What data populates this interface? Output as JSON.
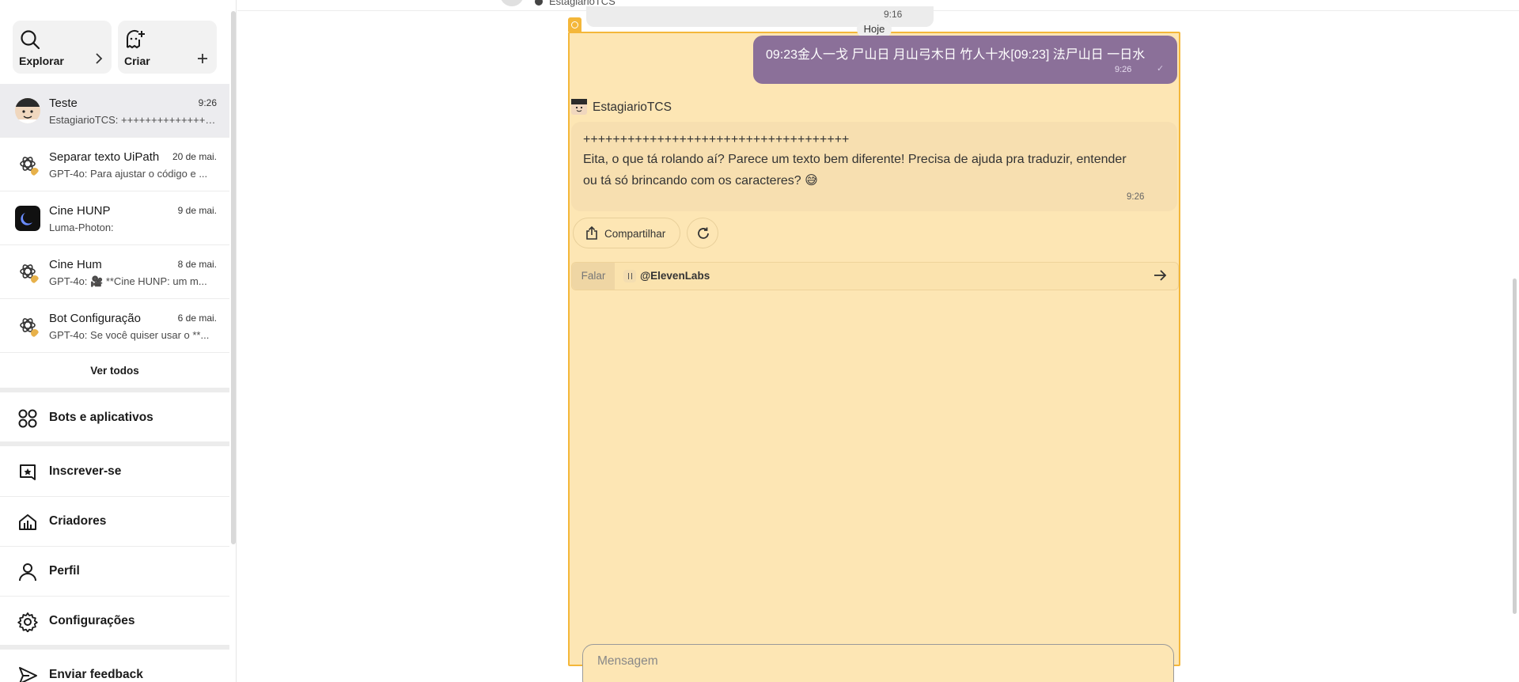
{
  "header": {
    "bot_name": "EstagiarioTCS"
  },
  "sidebar": {
    "explore_label": "Explorar",
    "create_label": "Criar",
    "chats": [
      {
        "name": "Teste",
        "date": "9:26",
        "preview": "EstagiarioTCS: +++++++++++++++++++++++++++",
        "icon": "estagiario-avatar"
      },
      {
        "name": "Separar texto UiPath",
        "date": "20 de mai.",
        "preview": "GPT-4o: Para ajustar o código e ...",
        "icon": "gpt-avatar"
      },
      {
        "name": "Cine HUNP",
        "date": "9 de mai.",
        "preview": "Luma-Photon:",
        "icon": "luma-avatar"
      },
      {
        "name": "Cine Hum",
        "date": "8 de mai.",
        "preview": "GPT-4o: 🎥 **Cine HUNP: um m...",
        "icon": "gpt-avatar"
      },
      {
        "name": "Bot Configuração",
        "date": "6 de mai.",
        "preview": "GPT-4o: Se você quiser usar o **...",
        "icon": "gpt-avatar"
      }
    ],
    "see_all_label": "Ver todos",
    "nav": [
      {
        "label": "Bots e aplicativos",
        "icon": "apps-icon"
      },
      {
        "label": "Inscrever-se",
        "icon": "subscribe-icon"
      },
      {
        "label": "Criadores",
        "icon": "creators-icon"
      },
      {
        "label": "Perfil",
        "icon": "profile-icon"
      },
      {
        "label": "Configurações",
        "icon": "settings-icon"
      },
      {
        "label": "Enviar feedback",
        "icon": "send-icon"
      }
    ]
  },
  "conversation": {
    "previous_time": "9:16",
    "date_label": "Hoje",
    "user_message": {
      "text": "09:23金人一戈 尸山日 月山弓木日 竹人十水[09:23] 法尸山日 一日水",
      "time": "9:26",
      "check": "✓"
    },
    "bot_message": {
      "sender": "EstagiarioTCS",
      "line1": "++++++++++++++++++++++++++++++++++++",
      "line2": "Eita, o que tá rolando aí? Parece um texto bem diferente! Precisa de ajuda pra traduzir, entender",
      "line3": "ou tá só brincando com os caracteres? 😅",
      "time": "9:26"
    },
    "share_label": "Compartilhar",
    "speak_tab_label": "Falar",
    "speak_bot_label": "@ElevenLabs",
    "input_placeholder": "Mensagem"
  },
  "colors": {
    "panel_bg": "#fde6b4",
    "panel_border": "#f4b73a",
    "user_bubble": "#8b7099",
    "bot_bubble": "#f7dfb0"
  }
}
